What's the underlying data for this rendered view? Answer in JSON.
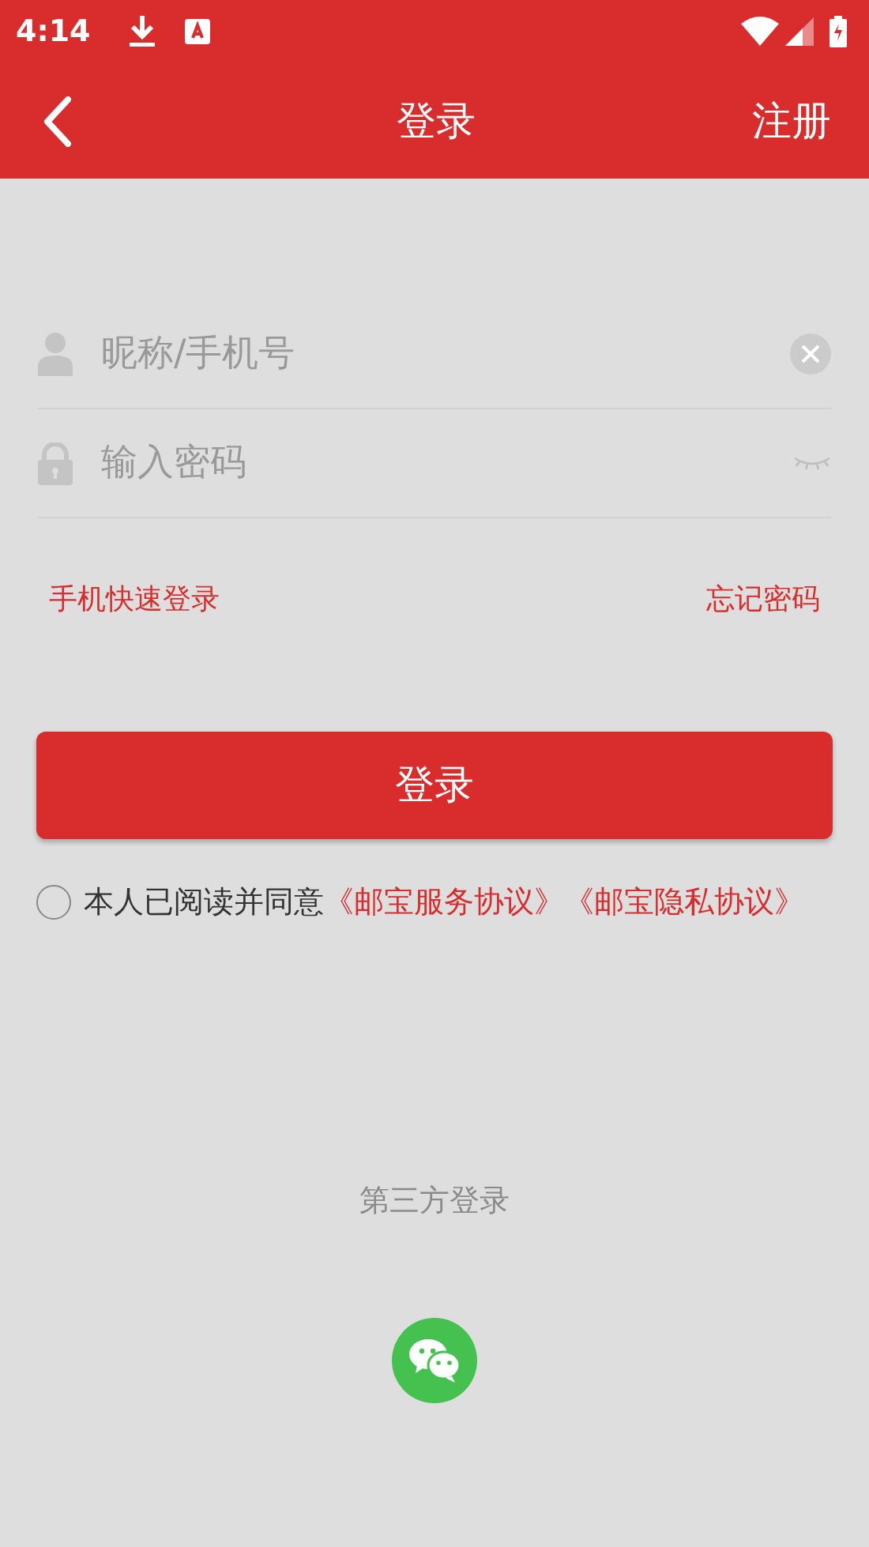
{
  "status_bar": {
    "time": "4:14"
  },
  "app_bar": {
    "title": "登录",
    "action": "注册"
  },
  "fields": [
    {
      "kind": "text",
      "placeholder": "昵称/手机号"
    },
    {
      "kind": "password",
      "placeholder": "输入密码"
    }
  ],
  "links": [
    "手机快速登录",
    "忘记密码"
  ],
  "login_button": "登录",
  "agreement": {
    "checked": false,
    "text": "本人已阅读并同意",
    "links": [
      "《邮宝服务协议》",
      "《邮宝隐私协议》"
    ]
  },
  "third_party": {
    "title": "第三方登录"
  }
}
